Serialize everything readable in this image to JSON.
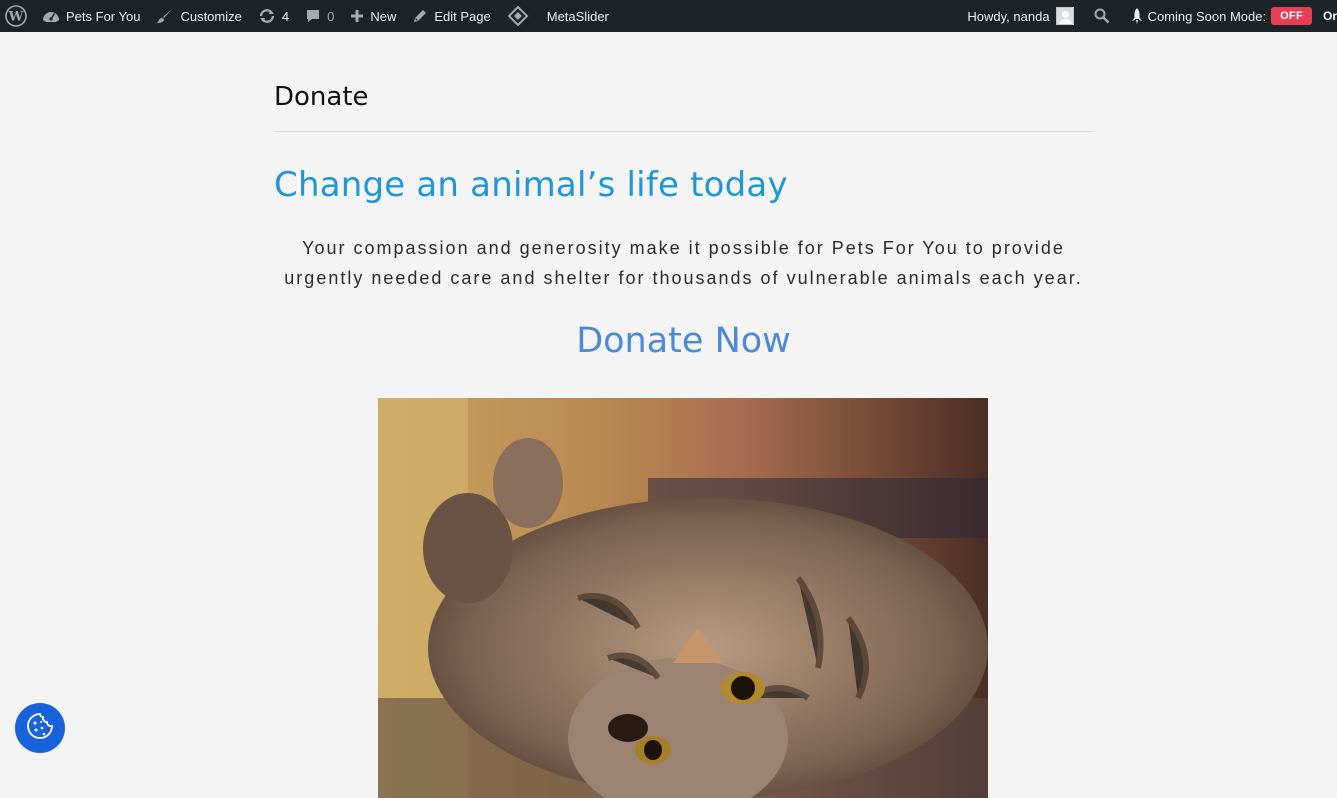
{
  "adminbar": {
    "site_name": "Pets For You",
    "customize": "Customize",
    "updates_count": "4",
    "comments_count": "0",
    "new": "New",
    "edit_page": "Edit Page",
    "metaslider": "MetaSlider",
    "howdy": "Howdy, nanda",
    "coming_soon_label": "Coming Soon Mode:",
    "coming_soon_status": "OFF",
    "cut_text": "Or"
  },
  "page": {
    "title": "Donate",
    "headline": "Change an animal’s life today",
    "intro": "Your compassion and generosity make it possible for Pets For You to provide urgently needed care and shelter for thousands of vulnerable animals each year.",
    "donate_link": "Donate Now"
  },
  "photo": {
    "subject": "tabby-cat-lying-on-back"
  },
  "colors": {
    "adminbar_bg": "#1d2327",
    "headline": "#1e96d8",
    "donate_link": "#4a8ad6",
    "off_badge": "#e53e55",
    "cookie_button": "#1863dc"
  },
  "icons": [
    "wordpress-icon",
    "dashboard-icon",
    "brush-icon",
    "update-icon",
    "comment-icon",
    "plus-icon",
    "pencil-icon",
    "metaslider-icon",
    "search-icon",
    "rocket-icon",
    "cookie-icon"
  ]
}
